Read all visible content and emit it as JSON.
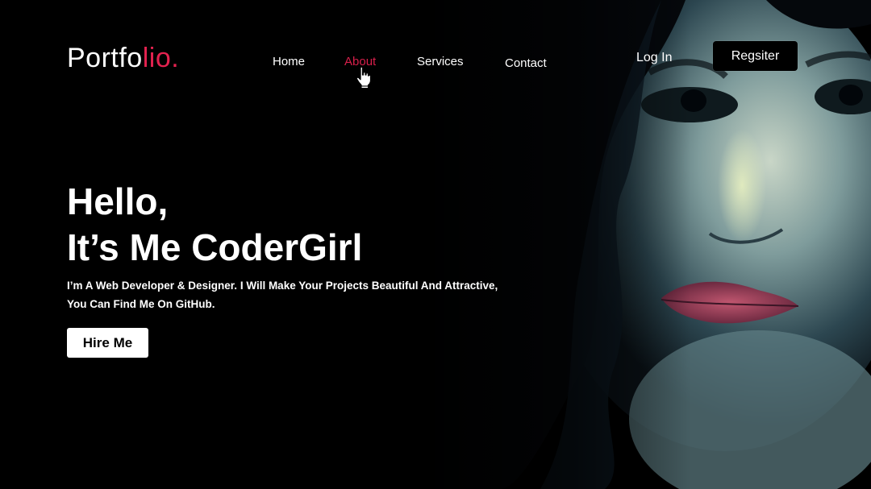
{
  "logo": {
    "text_main": "Portfo",
    "text_accent": "lio."
  },
  "nav": {
    "items": [
      {
        "label": "Home"
      },
      {
        "label": "About",
        "active": true
      },
      {
        "label": "Services"
      },
      {
        "label": "Contact"
      }
    ]
  },
  "auth": {
    "login_label": "Log In",
    "register_label": "Regsiter"
  },
  "hero": {
    "greeting": "Hello,",
    "title": "It’s Me CoderGirl",
    "subtitle_line1": "I’m A Web Developer & Designer. I Will Make Your Projects Beautiful And Attractive,",
    "subtitle_line2": "You Can Find Me On GitHub.",
    "cta_label": "Hire Me"
  },
  "colors": {
    "accent": "#e3224f",
    "background": "#000000",
    "text": "#ffffff"
  },
  "icons": {
    "cursor": "hand-pointer-icon"
  }
}
